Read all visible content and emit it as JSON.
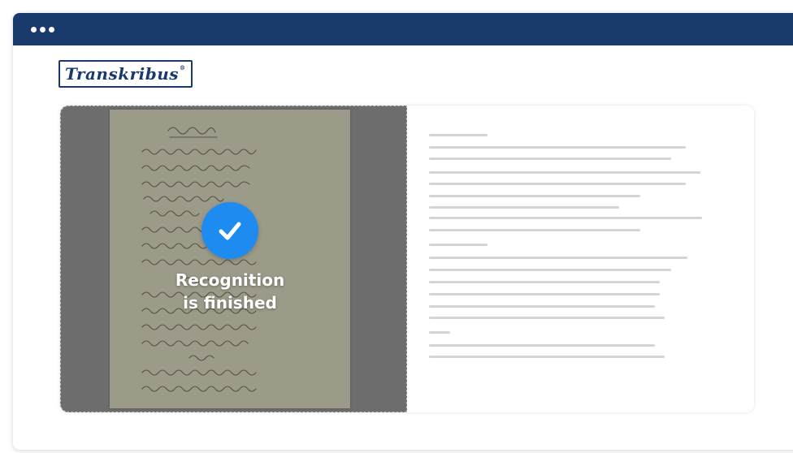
{
  "window": {
    "titlebar_color": "#1a3a6b",
    "menu_icon": "three-dots-icon"
  },
  "logo": {
    "text": "Transkribus",
    "mark": "®"
  },
  "status": {
    "icon": "checkmark-icon",
    "accent": "#1e8bf0",
    "line1": "Recognition",
    "line2": "is finished"
  }
}
